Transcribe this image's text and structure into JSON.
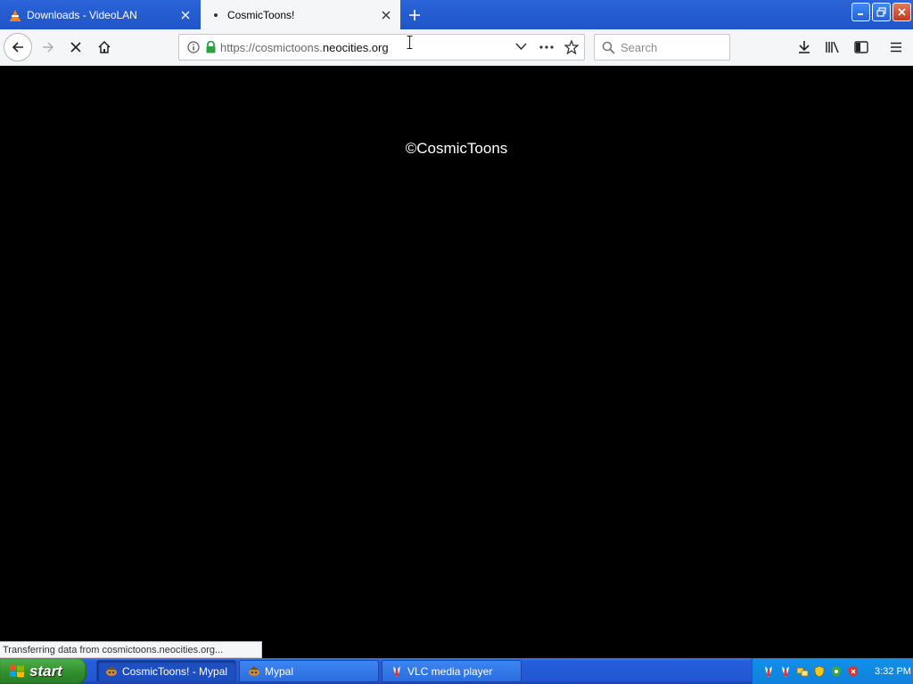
{
  "browser": {
    "tabs": [
      {
        "label": "Downloads - VideoLAN",
        "icon": "vlc-cone-icon",
        "active": false
      },
      {
        "label": "CosmicToons!",
        "icon": "loading-dot-icon",
        "active": true
      }
    ],
    "url": {
      "prefix": "https://cosmictoons.",
      "domain": "neocities.org"
    },
    "search_placeholder": "Search",
    "status_text": "Transferring data from cosmictoons.neocities.org..."
  },
  "page": {
    "copyright": "©CosmicToons"
  },
  "taskbar": {
    "start_label": "start",
    "items": [
      {
        "label": "CosmicToons! - Mypal",
        "icon": "mypal-icon",
        "active": true
      },
      {
        "label": "Mypal",
        "icon": "mypal-icon",
        "active": false
      },
      {
        "label": "VLC media player",
        "icon": "vlc-icon",
        "active": false
      }
    ],
    "clock": "3:32 PM"
  },
  "colors": {
    "titlebar": "#1f55c8",
    "taskbar": "#245edb",
    "start": "#2f8c2b",
    "secure_lock": "#2ea043",
    "page_bg": "#000000"
  }
}
